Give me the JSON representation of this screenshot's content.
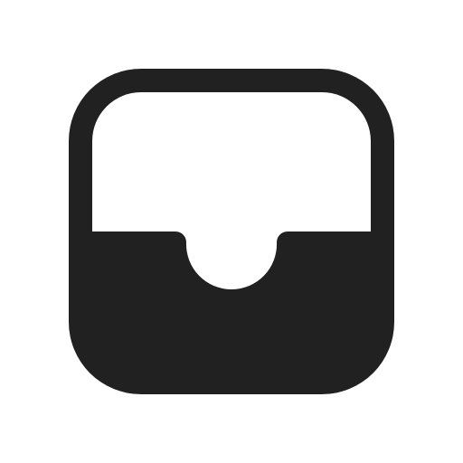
{
  "icon": {
    "name": "inbox-icon",
    "color": "#212121",
    "background": "#ffffff"
  }
}
